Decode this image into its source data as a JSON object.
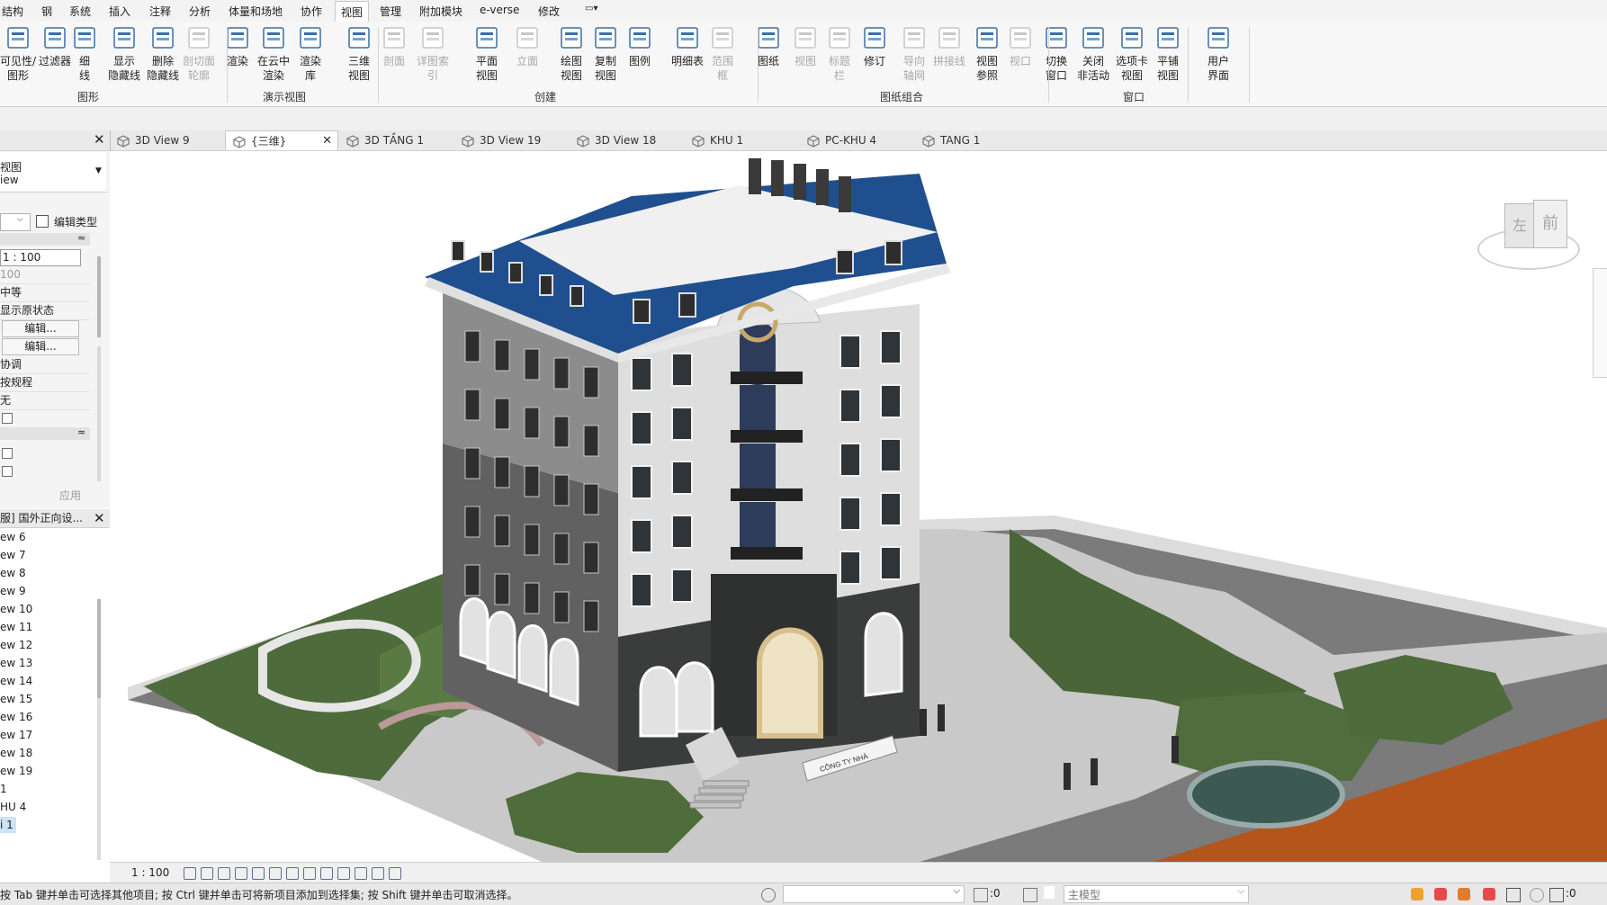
{
  "menu_tabs": [
    "结构",
    "钢",
    "系统",
    "插入",
    "注释",
    "分析",
    "体量和场地",
    "协作",
    "视图",
    "管理",
    "附加模块",
    "e-verse",
    "修改"
  ],
  "active_menu_tab": "视图",
  "ribbon": {
    "buttons": [
      {
        "label1": "可见性/",
        "label2": "图形",
        "icon": "visibility-graphics-icon",
        "disabled": false
      },
      {
        "label1": "过滤器",
        "label2": "",
        "icon": "filters-icon",
        "disabled": false
      },
      {
        "label1": "细",
        "label2": "线",
        "icon": "thin-lines-icon",
        "disabled": false
      },
      {
        "label1": "显示",
        "label2": "隐藏线",
        "icon": "show-hidden-lines-icon",
        "disabled": false
      },
      {
        "label1": "删除",
        "label2": "隐藏线",
        "icon": "remove-hidden-lines-icon",
        "disabled": false
      },
      {
        "label1": "剖切面",
        "label2": "轮廓",
        "icon": "cut-profile-icon",
        "disabled": true
      },
      {
        "label1": "渲染",
        "label2": "",
        "icon": "render-icon",
        "disabled": false
      },
      {
        "label1": "在云中",
        "label2": "渲染",
        "icon": "cloud-render-icon",
        "disabled": false
      },
      {
        "label1": "渲染",
        "label2": "库",
        "icon": "render-gallery-icon",
        "disabled": false
      },
      {
        "label1": "三维",
        "label2": "视图",
        "icon": "3d-view-icon",
        "disabled": false
      },
      {
        "label1": "剖面",
        "label2": "",
        "icon": "section-icon",
        "disabled": true
      },
      {
        "label1": "详图索引",
        "label2": "",
        "icon": "callout-icon",
        "disabled": true
      },
      {
        "label1": "平面",
        "label2": "视图",
        "icon": "plan-view-icon",
        "disabled": false
      },
      {
        "label1": "立面",
        "label2": "",
        "icon": "elevation-icon",
        "disabled": true
      },
      {
        "label1": "绘图",
        "label2": "视图",
        "icon": "drafting-view-icon",
        "disabled": false
      },
      {
        "label1": "复制",
        "label2": "视图",
        "icon": "duplicate-view-icon",
        "disabled": false
      },
      {
        "label1": "图例",
        "label2": "",
        "icon": "legends-icon",
        "disabled": false
      },
      {
        "label1": "明细表",
        "label2": "",
        "icon": "schedules-icon",
        "disabled": false
      },
      {
        "label1": "范围",
        "label2": "框",
        "icon": "scope-box-icon",
        "disabled": true
      },
      {
        "label1": "图纸",
        "label2": "",
        "icon": "sheet-icon",
        "disabled": false
      },
      {
        "label1": "视图",
        "label2": "",
        "icon": "place-view-icon",
        "disabled": true
      },
      {
        "label1": "标题",
        "label2": "栏",
        "icon": "title-block-icon",
        "disabled": true
      },
      {
        "label1": "修订",
        "label2": "",
        "icon": "revisions-icon",
        "disabled": false
      },
      {
        "label1": "导向",
        "label2": "轴网",
        "icon": "guide-grid-icon",
        "disabled": true
      },
      {
        "label1": "拼接线",
        "label2": "",
        "icon": "matchline-icon",
        "disabled": true
      },
      {
        "label1": "视图",
        "label2": "参照",
        "icon": "view-reference-icon",
        "disabled": false
      },
      {
        "label1": "视口",
        "label2": "",
        "icon": "viewports-icon",
        "disabled": true
      },
      {
        "label1": "切换",
        "label2": "窗口",
        "icon": "switch-windows-icon",
        "disabled": false
      },
      {
        "label1": "关闭",
        "label2": "非活动",
        "icon": "close-inactive-icon",
        "disabled": false
      },
      {
        "label1": "选项卡",
        "label2": "视图",
        "icon": "tab-views-icon",
        "disabled": false
      },
      {
        "label1": "平铺",
        "label2": "视图",
        "icon": "tile-views-icon",
        "disabled": false
      },
      {
        "label1": "用户",
        "label2": "界面",
        "icon": "user-interface-icon",
        "disabled": false
      }
    ],
    "groups": [
      "图形",
      "演示视图",
      "创建",
      "图纸组合",
      "窗口"
    ]
  },
  "view_tabs": [
    {
      "label": "3D View 9",
      "active": false,
      "close": false
    },
    {
      "label": "{三维}",
      "active": true,
      "close": true
    },
    {
      "label": "3D TẦNG 1",
      "active": false,
      "close": false
    },
    {
      "label": "3D View 19",
      "active": false,
      "close": false
    },
    {
      "label": "3D View 18",
      "active": false,
      "close": false
    },
    {
      "label": "KHU 1",
      "active": false,
      "close": false
    },
    {
      "label": "PC-KHU 4",
      "active": false,
      "close": false
    },
    {
      "label": "TANG 1",
      "active": false,
      "close": false
    }
  ],
  "properties": {
    "type_line1": "视图",
    "type_line2": "iew",
    "edit_type": "编辑类型",
    "rows": [
      "1 : 100",
      "100",
      "中等",
      "显示原状态",
      "编辑...",
      "编辑...",
      "协调",
      "按规程",
      "无"
    ],
    "apply": "应用"
  },
  "browser": {
    "title": "服] 国外正向设...",
    "items": [
      "ew 6",
      "ew 7",
      "ew 8",
      "ew 9",
      "ew 10",
      "ew 11",
      "ew 12",
      "ew 13",
      "ew 14",
      "ew 15",
      "ew 16",
      "ew 17",
      "ew 18",
      "ew 19",
      "1",
      "HU 4",
      "i 1"
    ]
  },
  "viewcube": {
    "left_face": "左",
    "front_face": "前"
  },
  "view_control": {
    "scale": "1 : 100"
  },
  "status": {
    "hint": "按 Tab 键并单击可选择其他项目; 按 Ctrl 键并单击可将新项目添加到选择集; 按 Shift 键并单击可取消选择。",
    "count_a": ":0",
    "model": "主模型",
    "filter_count": ":0"
  },
  "building_sign": "CÔNG TY NHÀ"
}
